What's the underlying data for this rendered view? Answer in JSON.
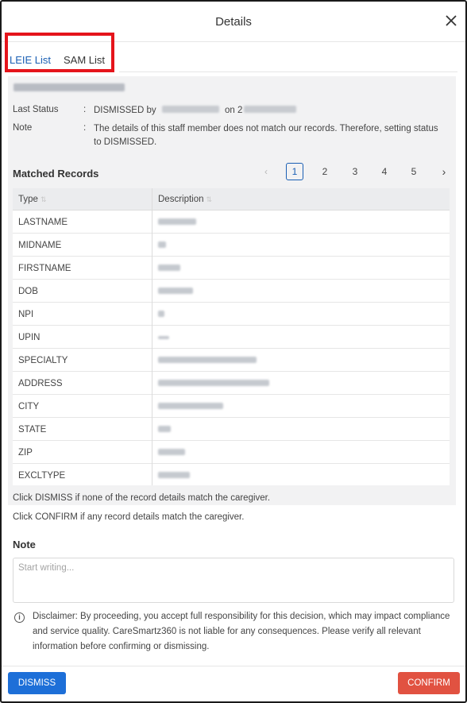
{
  "header": {
    "title": "Details",
    "close_glyph": "✕"
  },
  "tabs": [
    {
      "label": "LEIE List",
      "active": true
    },
    {
      "label": "SAM List",
      "active": false
    }
  ],
  "status": {
    "last_status_label": "Last Status",
    "last_status_value_prefix": "DISMISSED by",
    "last_status_value_mid": "on 2",
    "note_label": "Note",
    "note_value": "The details of this staff member does not match our records. Therefore, setting status to DISMISSED.",
    "separator": ":"
  },
  "matched": {
    "title": "Matched Records",
    "pagination": {
      "prev": "‹",
      "next": "›",
      "pages": [
        "1",
        "2",
        "3",
        "4",
        "5"
      ],
      "current": "1"
    },
    "columns": {
      "type": "Type",
      "description": "Description",
      "sort_glyph": "⇅"
    },
    "rows": [
      {
        "type": "LASTNAME"
      },
      {
        "type": "MIDNAME"
      },
      {
        "type": "FIRSTNAME"
      },
      {
        "type": "DOB"
      },
      {
        "type": "NPI"
      },
      {
        "type": "UPIN"
      },
      {
        "type": "SPECIALTY"
      },
      {
        "type": "ADDRESS"
      },
      {
        "type": "CITY"
      },
      {
        "type": "STATE"
      },
      {
        "type": "ZIP"
      },
      {
        "type": "EXCLTYPE"
      }
    ]
  },
  "hints": {
    "dismiss": "Click DISMISS if none of the record details match the caregiver.",
    "confirm": "Click CONFIRM if any record details match the caregiver."
  },
  "note": {
    "title": "Note",
    "placeholder": "Start writing..."
  },
  "disclaimer": {
    "icon": "info-icon",
    "icon_glyph": "i",
    "text": "Disclaimer: By proceeding, you accept full responsibility for this decision, which may impact compliance and service quality. CareSmartz360 is not liable for any consequences. Please verify all relevant information before confirming or dismissing."
  },
  "actions": {
    "dismiss": "DISMISS",
    "confirm": "CONFIRM"
  },
  "colors": {
    "accent": "#1d6fd8",
    "danger": "#e15241",
    "highlight": "#e5141b"
  }
}
